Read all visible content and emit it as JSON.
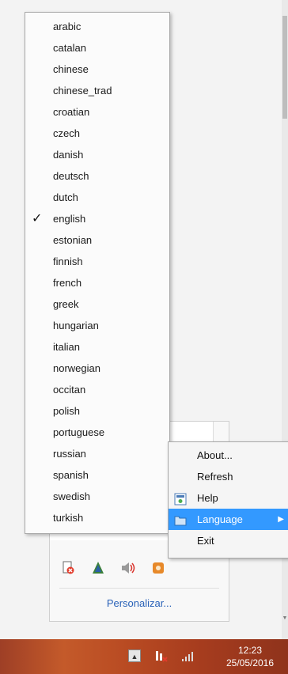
{
  "language_menu": {
    "selected": "english",
    "items": [
      "arabic",
      "catalan",
      "chinese",
      "chinese_trad",
      "croatian",
      "czech",
      "danish",
      "deutsch",
      "dutch",
      "english",
      "estonian",
      "finnish",
      "french",
      "greek",
      "hungarian",
      "italian",
      "norwegian",
      "occitan",
      "polish",
      "portuguese",
      "russian",
      "spanish",
      "swedish",
      "turkish"
    ]
  },
  "context_menu": {
    "about": "About...",
    "refresh": "Refresh",
    "help": "Help",
    "language": "Language",
    "exit": "Exit"
  },
  "tray_panel": {
    "customize": "Personalizar...",
    "icons": [
      "network-error-icon",
      "app-tray-icon",
      "volume-icon",
      "app-orange-icon"
    ]
  },
  "taskbar": {
    "time": "12:23",
    "date": "25/05/2016"
  },
  "colors": {
    "highlight": "#3399ff",
    "link": "#2b63b8",
    "taskbar": "#b84a22"
  }
}
